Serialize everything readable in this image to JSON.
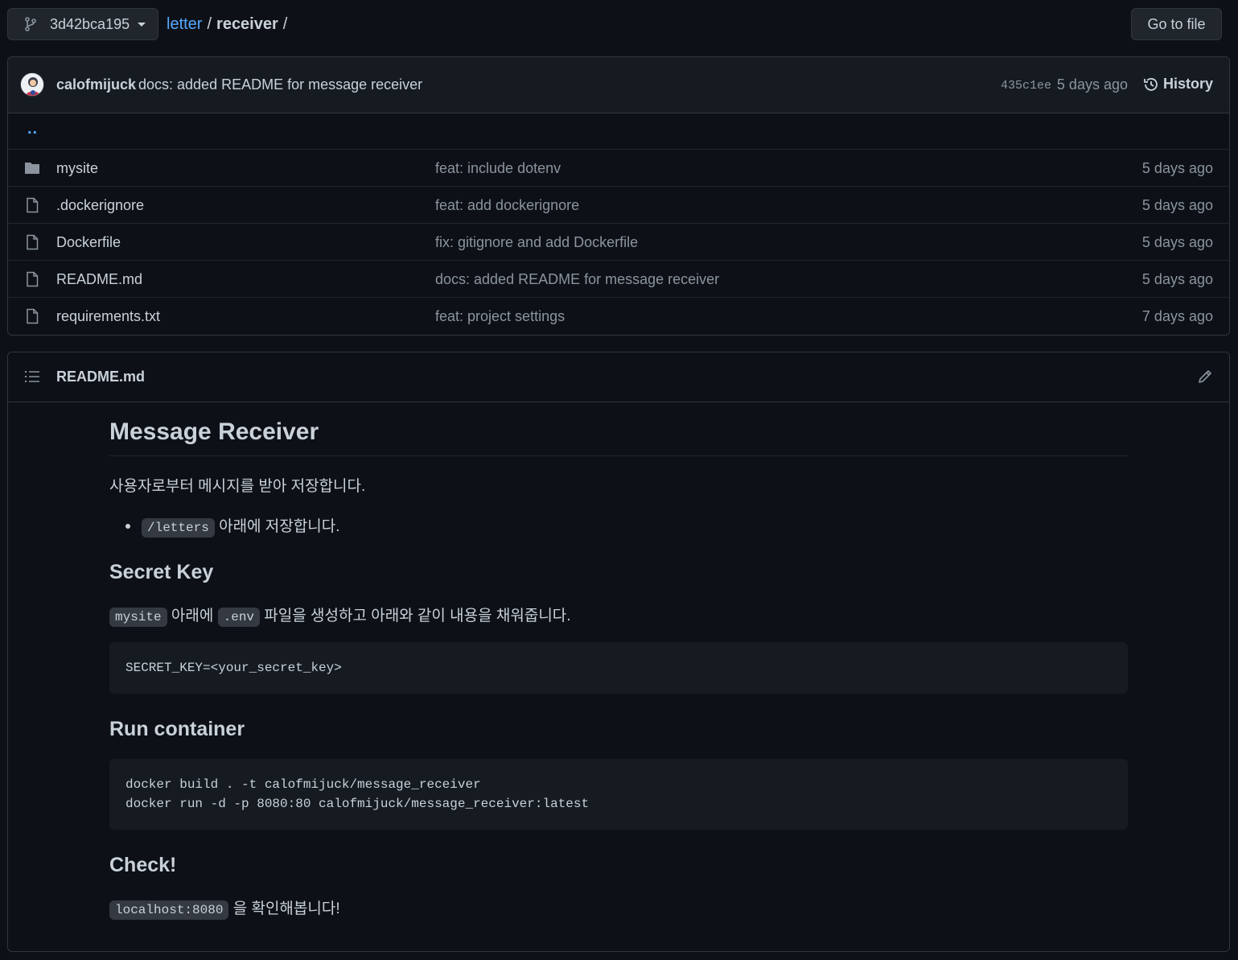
{
  "header": {
    "branch": "3d42bca195",
    "breadcrumb": {
      "repo": "letter",
      "sep1": "/",
      "dir": "receiver",
      "sep2": "/"
    },
    "goto_label": "Go to file"
  },
  "latest_commit": {
    "author": "calofmijuck",
    "message": "docs: added README for message receiver",
    "sha": "435c1ee",
    "time": "5 days ago",
    "history_label": "History"
  },
  "parent_dir": "..",
  "files": [
    {
      "type": "folder",
      "name": "mysite",
      "message": "feat: include dotenv",
      "time": "5 days ago"
    },
    {
      "type": "file",
      "name": ".dockerignore",
      "message": "feat: add dockerignore",
      "time": "5 days ago"
    },
    {
      "type": "file",
      "name": "Dockerfile",
      "message": "fix: gitignore and add Dockerfile",
      "time": "5 days ago"
    },
    {
      "type": "file",
      "name": "README.md",
      "message": "docs: added README for message receiver",
      "time": "5 days ago"
    },
    {
      "type": "file",
      "name": "requirements.txt",
      "message": "feat: project settings",
      "time": "7 days ago"
    }
  ],
  "readme": {
    "filename": "README.md",
    "h1": "Message Receiver",
    "intro": "사용자로부터 메시지를 받아 저장합니다.",
    "bullet_code": "/letters",
    "bullet_text": " 아래에 저장합니다.",
    "h2_secret": "Secret Key",
    "secret_code1": "mysite",
    "secret_text1": " 아래에 ",
    "secret_code2": ".env",
    "secret_text2": " 파일을 생성하고 아래와 같이 내용을 채워줍니다.",
    "secret_block": "SECRET_KEY=<your_secret_key>",
    "h2_run": "Run container",
    "run_line1": "docker build . -t calofmijuck/message_receiver",
    "run_line2": "docker run -d -p 8080:80 calofmijuck/message_receiver:latest",
    "h2_check": "Check!",
    "check_code": "localhost:8080",
    "check_text": " 을 확인해봅니다!"
  },
  "colors": {
    "background": "#0d1117",
    "link": "#58a6ff",
    "muted": "#8b949e",
    "border": "#30363d"
  }
}
